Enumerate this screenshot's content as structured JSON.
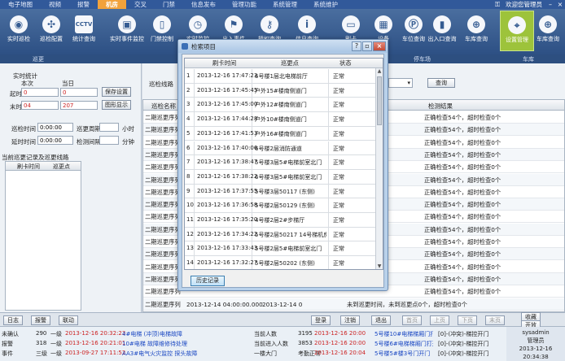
{
  "menu": {
    "items": [
      "电子地图",
      "视频",
      "报警",
      "机房",
      "交叉",
      "门禁",
      "信息发布",
      "管理功能",
      "系统管理",
      "系统维护"
    ],
    "active_index": 3,
    "user": "欢迎您管理员"
  },
  "toolbar": {
    "items": [
      {
        "label": "实时巡检",
        "icon": "patrol-icon"
      },
      {
        "label": "巡检配置",
        "icon": "config-icon"
      },
      {
        "label": "统计查询",
        "icon": "cctv-icon"
      },
      {
        "label": "实时事件监控",
        "icon": "event-icon"
      },
      {
        "label": "门禁控制",
        "icon": "door-icon"
      },
      {
        "label": "实时监控",
        "icon": "clock-icon"
      },
      {
        "label": "出入事件",
        "icon": "flag-icon"
      },
      {
        "label": "授权查询",
        "icon": "key-icon"
      },
      {
        "label": "信息查询",
        "icon": "info-icon"
      },
      {
        "label": "刷卡",
        "icon": "card-icon"
      },
      {
        "label": "设备",
        "icon": "device-icon"
      },
      {
        "label": "车位查询",
        "icon": "parking-icon"
      },
      {
        "label": "出入口查询",
        "icon": "chart-icon"
      },
      {
        "label": "车库查询",
        "icon": "search-icon"
      },
      {
        "label": "设置管理",
        "icon": "location-icon"
      },
      {
        "label": "车库查询",
        "icon": "search-icon"
      }
    ],
    "selected_index": 14,
    "groups": [
      "巡更",
      "停车场",
      "车库"
    ]
  },
  "left": {
    "title": "实时统计",
    "col1": "本次",
    "col2": "当日",
    "start_label": "起时",
    "end_label": "末时",
    "start_val": "0",
    "end_val": "04",
    "start_val2": "0",
    "end_val2": "207",
    "save_btn": "保存设置",
    "show_btn": "图形显示",
    "patrol_label": "巡检时间",
    "patrol_val": "0:00:00",
    "cycle_label": "巡更周期",
    "cycle_unit": "小时",
    "delay_label": "延时时间",
    "delay_val": "0:00:00",
    "interval_label": "检测间隔",
    "interval_unit": "分钟",
    "section": "当前巡更记录及巡更线路",
    "card_time_col": "刷卡时间",
    "point_col": "巡更点"
  },
  "center": {
    "route_label": "巡检线路",
    "query_btn": "查询",
    "cols": [
      "巡检名称",
      "",
      "",
      "",
      "检测结果"
    ],
    "rows": [
      {
        "name": "二期巡更序列",
        "result": "正确检查54个，超时检查0个"
      },
      {
        "name": "二期巡更序列",
        "result": "正确检查54个，超时检查0个"
      },
      {
        "name": "二期巡更序列",
        "result": "正确检查54个，超时检查0个"
      },
      {
        "name": "二期巡更序列",
        "result": "正确检查54个，超时检查0个"
      },
      {
        "name": "二期巡更序列",
        "result": "正确检查54个，超时检查0个"
      },
      {
        "name": "二期巡更序列",
        "result": "正确检查54个，超时检查0个"
      },
      {
        "name": "二期巡更序列",
        "result": "正确检查54个，超时检查0个"
      },
      {
        "name": "二期巡更序列",
        "result": "正确检查54个，超时检查0个"
      },
      {
        "name": "二期巡更序列",
        "result": "正确检查54个，超时检查0个"
      },
      {
        "name": "二期巡更序列",
        "result": "正确检查54个，超时检查0个"
      },
      {
        "name": "二期巡更序列",
        "result": "正确检查54个，超时检查0个"
      },
      {
        "name": "二期巡更序列",
        "result": "正确检查54个，超时检查0个"
      },
      {
        "name": "二期巡更序列",
        "result": "正确检查54个，超时检查0个"
      },
      {
        "name": "二期巡更序列",
        "result": "正确检查54个，超时检查0个"
      },
      {
        "name": "二期巡更序列",
        "result": "正确检查54个，超时检查0个"
      },
      {
        "name": "二期巡更序列",
        "time1": "2013-12-14 04:00:00.000",
        "time2": "2013-12-14 0",
        "result": "未到巡更时间，未到巡更点0个，超时检查0个"
      }
    ]
  },
  "bottom": {
    "buttons": [
      "日志",
      "报警",
      "联动",
      "登录",
      "注销",
      "退出",
      "首页",
      "上页",
      "下页",
      "末页",
      "转到",
      "查找",
      "收藏",
      "开放"
    ]
  },
  "status": {
    "rows": [
      {
        "a": "未确认",
        "n": "290",
        "lvl": "一级",
        "t": "2013-12-16 20:32:23",
        "d": "4#电梯 (冲顶)电梯故障",
        "b": "当前人数",
        "bn": "3195",
        "bt": "2013-12-16 20:00",
        "c": "5号楼10#电梯梯厢门打开",
        "e": "[0]-(冲突)-梯控开门"
      },
      {
        "a": "报警",
        "n": "318",
        "lvl": "一级",
        "t": "2013-12-16 20:21:01",
        "d": "10#电梯 故障维修待处理",
        "b": "当前进入人数",
        "bn": "3853",
        "bt": "2013-12-16 20:00",
        "c": "5号楼6#电梯梯厢门打开",
        "e": "[0]-(冲突)-梯控开门"
      },
      {
        "a": "事件",
        "n": "三级",
        "lvl": "一级",
        "t": "2013-09-27 17:11:52",
        "d": "AA3#电气火灾监控 探头故障",
        "b": "一楼大门",
        "bn": "考勤正常",
        "bt": "2013-12-16 20:04",
        "c": "5号楼5#楼3号门开门",
        "e": "[0]-(冲突)-梯控开门"
      }
    ],
    "clock_user": "sysadmin",
    "clock_role": "管理员",
    "clock_time": "2013-12-16 20:34:38"
  },
  "dialog": {
    "title": "检索项目",
    "cols": [
      "",
      "刷卡时间",
      "巡更点",
      "状态"
    ],
    "rows": [
      {
        "n": "1",
        "t": "2013-12-16 17:47:23",
        "p": "6号楼1层北电梯前厅",
        "s": "正常"
      },
      {
        "n": "2",
        "t": "2013-12-16 17:45:45",
        "p": "户外15#楼南侧道门",
        "s": "正常"
      },
      {
        "n": "3",
        "t": "2013-12-16 17:45:00",
        "p": "户外12#楼南侧道门",
        "s": "正常"
      },
      {
        "n": "4",
        "t": "2013-12-16 17:44:28",
        "p": "户外10#楼南侧道门",
        "s": "正常"
      },
      {
        "n": "5",
        "t": "2013-12-16 17:41:53",
        "p": "户外16#楼南侧道门",
        "s": "正常"
      },
      {
        "n": "6",
        "t": "2013-12-16 17:40:06",
        "p": "6号楼2层消防通道",
        "s": "正常"
      },
      {
        "n": "7",
        "t": "2013-12-16 17:38:47",
        "p": "5号楼3层5#电梯前室北门",
        "s": "正常"
      },
      {
        "n": "8",
        "t": "2013-12-16 17:38:22",
        "p": "6号楼3层5#电梯前室北门",
        "s": "正常"
      },
      {
        "n": "9",
        "t": "2013-12-16 17:37:55",
        "p": "5号楼3层50117 (东侧)",
        "s": "正常"
      },
      {
        "n": "10",
        "t": "2013-12-16 17:36:58",
        "p": "5号楼2层50129 (东侧)",
        "s": "正常"
      },
      {
        "n": "11",
        "t": "2013-12-16 17:35:20",
        "p": "4号楼2层2#步梯厅",
        "s": "正常"
      },
      {
        "n": "12",
        "t": "2013-12-16 17:34:22",
        "p": "5号楼2层50217 14号梯机房门门",
        "s": "正常"
      },
      {
        "n": "13",
        "t": "2013-12-16 17:33:43",
        "p": "5号楼2层5#电梯前室北门",
        "s": "正常"
      },
      {
        "n": "14",
        "t": "2013-12-16 17:32:27",
        "p": "5号楼2层50202 (东侧)",
        "s": "正常"
      }
    ],
    "ok_btn": "历史记录"
  }
}
